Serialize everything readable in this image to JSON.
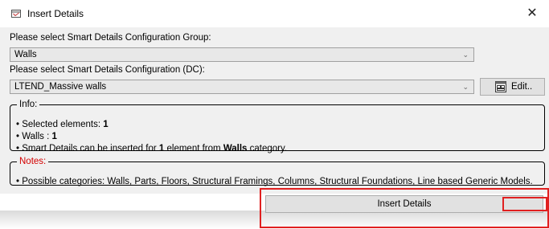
{
  "window": {
    "title": "Insert Details",
    "close_glyph": "✕",
    "icon": "insert-details-icon"
  },
  "config_group": {
    "label": "Please select Smart Details Configuration Group:",
    "selected": "Walls"
  },
  "config": {
    "label": "Please select Smart Details Configuration (DC):",
    "selected": "LTEND_Massive walls"
  },
  "edit_button": {
    "label": "Edit..",
    "icon": "edit-icon"
  },
  "info": {
    "legend": "Info:",
    "selected_prefix": "• Selected elements:",
    "selected_count": "1",
    "walls_prefix": "• Walls  :",
    "walls_count": "1",
    "insert_prefix": "• Smart Details can be inserted for",
    "insert_count": "1",
    "insert_middle": "element from",
    "insert_category": "Walls",
    "insert_suffix": "category."
  },
  "notes": {
    "legend": "Notes:",
    "text": "• Possible categories: Walls, Parts, Floors, Structural Framings, Columns, Structural Foundations, Line based Generic Models."
  },
  "insert_button": {
    "label": "Insert Details"
  },
  "colors": {
    "highlight": "#e02020",
    "notes_legend": "#d40000"
  }
}
